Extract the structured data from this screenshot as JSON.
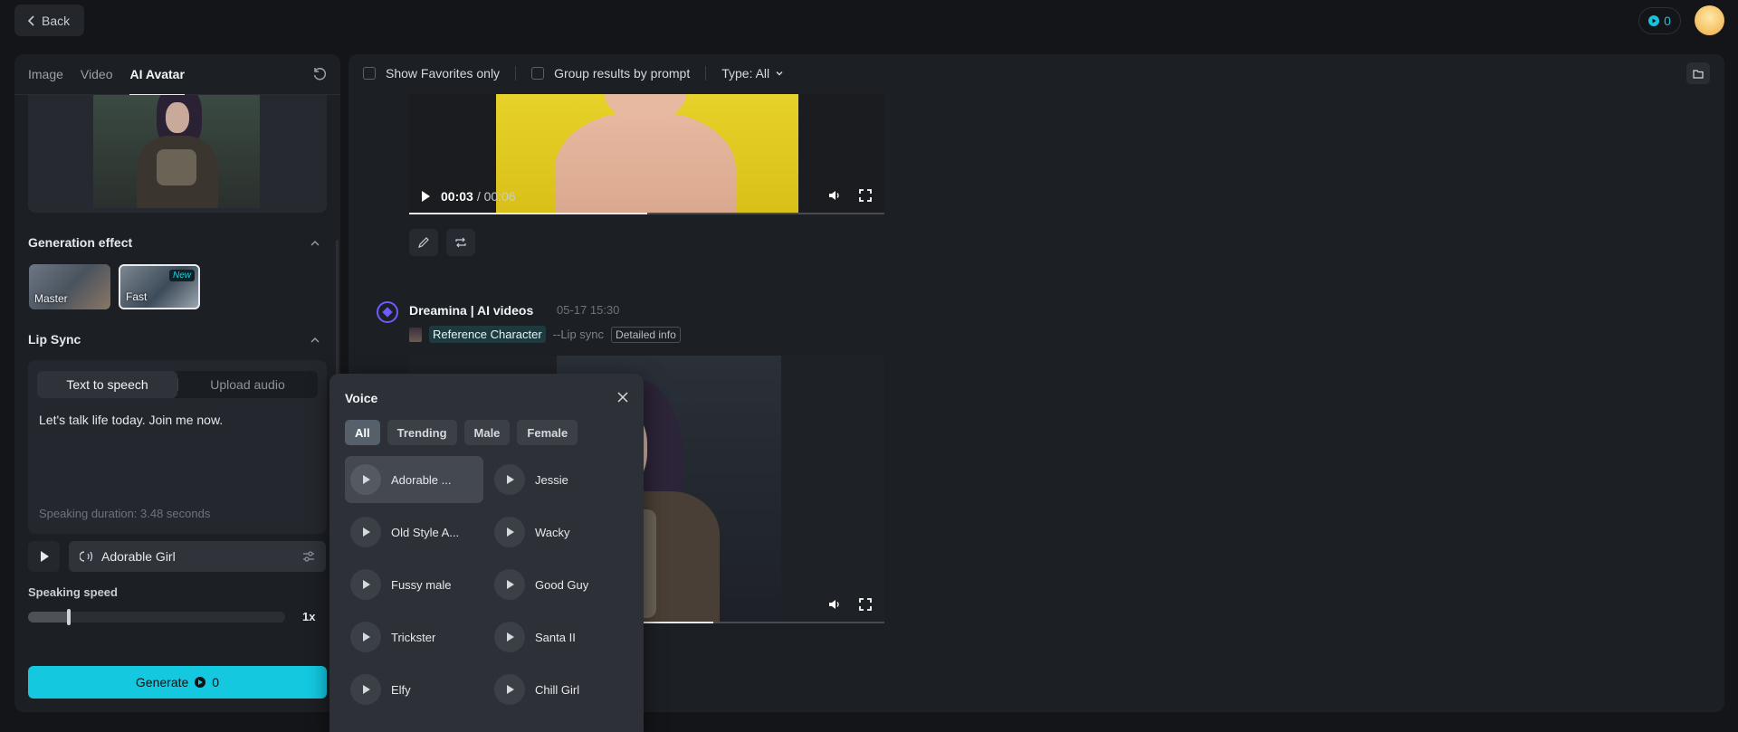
{
  "header": {
    "back_label": "Back",
    "credits": "0"
  },
  "left_panel": {
    "tabs": [
      {
        "label": "Image"
      },
      {
        "label": "Video"
      },
      {
        "label": "AI Avatar",
        "active": true
      }
    ],
    "generation_effect": {
      "title": "Generation effect",
      "options": [
        {
          "label": "Master",
          "selected": false
        },
        {
          "label": "Fast",
          "selected": true,
          "badge": "New"
        }
      ]
    },
    "lip_sync": {
      "title": "Lip Sync",
      "modes": [
        {
          "label": "Text to speech",
          "active": true
        },
        {
          "label": "Upload audio",
          "active": false
        }
      ],
      "text": "Let's talk life today. Join me now.",
      "duration": "Speaking duration: 3.48 seconds",
      "voice": "Adorable Girl"
    },
    "speaking_speed": {
      "title": "Speaking speed",
      "value": "1x",
      "level": 0.16
    },
    "generate": {
      "label": "Generate",
      "cost": "0"
    }
  },
  "filters": {
    "favorites": "Show Favorites only",
    "group": "Group results by prompt",
    "type": "Type: All"
  },
  "results": {
    "video1": {
      "time_current": "00:03",
      "time_total": "/ 00:06",
      "progress": 0.5
    },
    "generation": {
      "source": "Dreamina | AI videos",
      "timestamp": "05-17  15:30",
      "reference": "Reference Character",
      "tag": "--Lip sync",
      "detail": "Detailed info"
    },
    "video2": {
      "progress": 0.64
    }
  },
  "voice_popup": {
    "title": "Voice",
    "filters": [
      {
        "label": "All",
        "active": true
      },
      {
        "label": "Trending"
      },
      {
        "label": "Male"
      },
      {
        "label": "Female"
      }
    ],
    "voices": [
      {
        "name": "Adorable ...",
        "selected": true
      },
      {
        "name": "Jessie"
      },
      {
        "name": "Old Style A..."
      },
      {
        "name": "Wacky"
      },
      {
        "name": "Fussy male"
      },
      {
        "name": "Good Guy"
      },
      {
        "name": "Trickster"
      },
      {
        "name": "Santa II"
      },
      {
        "name": "Elfy"
      },
      {
        "name": "Chill Girl"
      }
    ]
  },
  "colors": {
    "accent": "#14c8e0",
    "brand_logo": "#6b5cff"
  }
}
